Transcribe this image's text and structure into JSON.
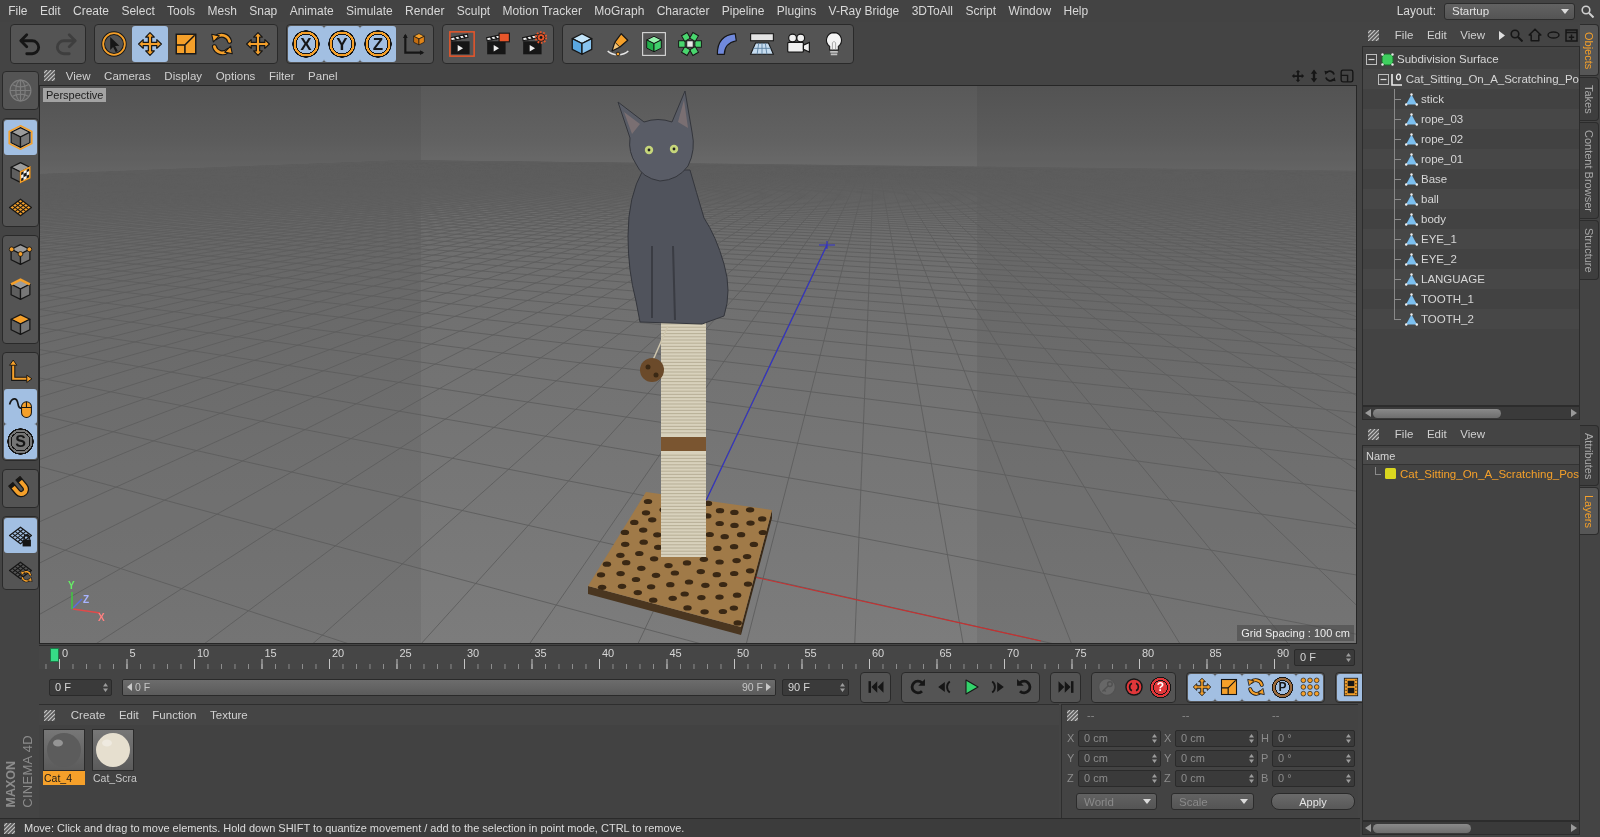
{
  "menu_bar": {
    "items": [
      "File",
      "Edit",
      "Create",
      "Select",
      "Tools",
      "Mesh",
      "Snap",
      "Animate",
      "Simulate",
      "Render",
      "Sculpt",
      "Motion Tracker",
      "MoGraph",
      "Character",
      "Pipeline",
      "Plugins",
      "V-Ray Bridge",
      "3DToAll",
      "Script",
      "Window",
      "Help"
    ],
    "layout_label": "Layout:",
    "layout_value": "Startup"
  },
  "toolbar": {
    "groups": [
      [
        {
          "kind": "undo",
          "active": false,
          "disabled": false
        },
        {
          "kind": "redo",
          "active": false,
          "disabled": true
        }
      ],
      [
        {
          "kind": "select",
          "active": false
        },
        {
          "kind": "move",
          "active": true
        },
        {
          "kind": "scale",
          "active": false
        },
        {
          "kind": "rotate",
          "active": false
        },
        {
          "kind": "transform",
          "active": false
        }
      ],
      [
        {
          "kind": "axis",
          "label": "X",
          "active": true
        },
        {
          "kind": "axis",
          "label": "Y",
          "active": true
        },
        {
          "kind": "axis",
          "label": "Z",
          "active": true
        },
        {
          "kind": "coordinates",
          "active": false
        }
      ],
      [
        {
          "kind": "render_view",
          "active": false
        },
        {
          "kind": "render_picture",
          "active": false
        },
        {
          "kind": "render_settings",
          "active": false
        }
      ],
      [
        {
          "kind": "cube",
          "active": false
        },
        {
          "kind": "pen",
          "active": false
        },
        {
          "kind": "subdivision",
          "active": false
        },
        {
          "kind": "cloner",
          "active": false
        },
        {
          "kind": "bend",
          "active": false
        },
        {
          "kind": "floor",
          "active": false
        },
        {
          "kind": "camera",
          "active": false
        },
        {
          "kind": "light",
          "active": false
        }
      ]
    ]
  },
  "mode_bar": {
    "groups": [
      [
        {
          "kind": "make_editable",
          "active": false,
          "disabled": true
        }
      ],
      [
        {
          "kind": "model",
          "active": true
        },
        {
          "kind": "texture",
          "active": false
        },
        {
          "kind": "workplane",
          "active": false
        }
      ],
      [
        {
          "kind": "points",
          "active": false
        },
        {
          "kind": "edges",
          "active": false
        },
        {
          "kind": "polygons",
          "active": false
        }
      ],
      [
        {
          "kind": "axis_mode",
          "active": false
        },
        {
          "kind": "tweak",
          "active": true
        },
        {
          "kind": "snap",
          "label": "S",
          "active": true
        }
      ],
      [
        {
          "kind": "magnet",
          "active": false
        }
      ],
      [
        {
          "kind": "workplane_lock",
          "active": true
        },
        {
          "kind": "workplane_rotate",
          "active": false
        }
      ]
    ],
    "logo": [
      "MAXON",
      "CINEMA 4D"
    ]
  },
  "viewport": {
    "menu": [
      "View",
      "Cameras",
      "Display",
      "Options",
      "Filter",
      "Panel"
    ],
    "camera": "Perspective",
    "grid_spacing": "Grid Spacing : 100 cm",
    "gizmo_axes": [
      "Y",
      "Z",
      "X"
    ]
  },
  "timeline": {
    "ticks": [
      "0",
      "5",
      "10",
      "15",
      "20",
      "25",
      "30",
      "35",
      "40",
      "45",
      "50",
      "55",
      "60",
      "65",
      "70",
      "75",
      "80",
      "85",
      "90"
    ],
    "playhead": {
      "level": 0
    },
    "current_frame": "0 F"
  },
  "playback": {
    "start_frame": "0 F",
    "range": {
      "start": "0 F",
      "end": "90 F",
      "level": 1
    },
    "end_frame": "90 F",
    "groups": [
      [
        {
          "kind": "go_start",
          "active": false
        }
      ],
      [
        {
          "kind": "prev_key",
          "active": false
        },
        {
          "kind": "prev_frame",
          "active": false
        },
        {
          "kind": "play",
          "active": false
        },
        {
          "kind": "next_frame",
          "active": false
        },
        {
          "kind": "next_key",
          "active": false
        }
      ],
      [
        {
          "kind": "go_end",
          "active": false
        }
      ],
      [
        {
          "kind": "autokey",
          "active": false,
          "disabled": true
        },
        {
          "kind": "record",
          "active": false,
          "disabled": false
        },
        {
          "kind": "help",
          "label": "?",
          "active": false,
          "disabled": false
        }
      ],
      [
        {
          "kind": "key_move",
          "active": true
        },
        {
          "kind": "key_scale",
          "active": true
        },
        {
          "kind": "key_rotate",
          "active": true
        },
        {
          "kind": "key_param",
          "label": "P",
          "active": true
        },
        {
          "kind": "key_pla",
          "active": true
        }
      ],
      [
        {
          "kind": "timeline",
          "active": true
        }
      ]
    ]
  },
  "materials": {
    "menu": [
      "Create",
      "Edit",
      "Function",
      "Texture"
    ],
    "items": [
      {
        "name": "Cat_4",
        "selected": true,
        "color": "#5c5c5c"
      },
      {
        "name": "Cat_Scra",
        "selected": false,
        "color": "#e6dfcf"
      }
    ]
  },
  "coordinates": {
    "disabled": true,
    "columns": [
      {
        "header": "--",
        "rows": [
          {
            "axis": "X",
            "value": "0 cm"
          },
          {
            "axis": "Y",
            "value": "0 cm"
          },
          {
            "axis": "Z",
            "value": "0 cm"
          }
        ]
      },
      {
        "header": "--",
        "rows": [
          {
            "axis": "X",
            "value": "0 cm"
          },
          {
            "axis": "Y",
            "value": "0 cm"
          },
          {
            "axis": "Z",
            "value": "0 cm"
          }
        ]
      },
      {
        "header": "--",
        "rows": [
          {
            "axis": "H",
            "value": "0 °"
          },
          {
            "axis": "P",
            "value": "0 °"
          },
          {
            "axis": "B",
            "value": "0 °"
          }
        ]
      }
    ],
    "space": "World",
    "mode": "Scale",
    "apply": "Apply"
  },
  "status_bar": "Move: Click and drag to move elements. Hold down SHIFT to quantize movement / add to the selection in point mode, CTRL to remove.",
  "objects_panel": {
    "menu": [
      "File",
      "Edit",
      "View"
    ],
    "tree": [
      {
        "name": "Subdivision Surface",
        "kind": "subdivision",
        "expanded": true,
        "children": [
          {
            "name": "Cat_Sitting_On_A_Scratching_Po",
            "kind": "null",
            "expanded": true,
            "children": [
              {
                "name": "stick",
                "kind": "polygon"
              },
              {
                "name": "rope_03",
                "kind": "polygon"
              },
              {
                "name": "rope_02",
                "kind": "polygon"
              },
              {
                "name": "rope_01",
                "kind": "polygon"
              },
              {
                "name": "Base",
                "kind": "polygon"
              },
              {
                "name": "ball",
                "kind": "polygon"
              },
              {
                "name": "body",
                "kind": "polygon"
              },
              {
                "name": "EYE_1",
                "kind": "polygon"
              },
              {
                "name": "EYE_2",
                "kind": "polygon"
              },
              {
                "name": "LANGUAGE",
                "kind": "polygon"
              },
              {
                "name": "TOOTH_1",
                "kind": "polygon"
              },
              {
                "name": "TOOTH_2",
                "kind": "polygon"
              }
            ]
          }
        ]
      }
    ]
  },
  "layers_panel": {
    "menu": [
      "File",
      "Edit",
      "View"
    ],
    "column": "Name",
    "layers": [
      {
        "name": "Cat_Sitting_On_A_Scratching_Pos",
        "color": "#d9d61f",
        "selected": true
      }
    ]
  },
  "side_tabs": {
    "top": [
      {
        "label": "Objects",
        "selected": true
      },
      {
        "label": "Takes",
        "selected": false
      },
      {
        "label": "Content Browser",
        "selected": false
      },
      {
        "label": "Structure",
        "selected": false
      }
    ],
    "bottom": [
      {
        "label": "Attributes",
        "selected": false
      },
      {
        "label": "Layers",
        "selected": true
      }
    ]
  }
}
